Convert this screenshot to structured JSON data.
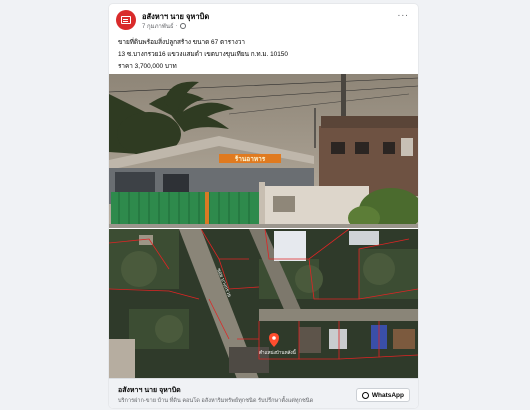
{
  "post": {
    "author": "อสังหาฯ นาย จุหาบิด",
    "time": "7 กุมภาพันธ์",
    "separator": "·",
    "more_label": "···",
    "text_lines": [
      "ขายที่ดินพร้อมสิ่งปลูกสร้าง  ขนาด  67  ตารางวา",
      "13  ซ.บางกรวย16  แขวงแสมดำ เขตบางขุนเทียน ก.ท.ม.   10150",
      "ราคา  3,700,000  บาท"
    ],
    "house_sign_text": "ร้านอาหาร",
    "map_pin_label": "ตำแหน่งบ้านหลังนี้",
    "map_road_label": "ซอย บางกรวย"
  },
  "footer": {
    "title": "อสังหาฯ นาย จุหาบิด",
    "subtitle": "บริการฝาก-ขาย บ้าน ที่ดิน คอนโด อสังหาริมทรัพย์ทุกชนิด รับปรึกษาตั้งแต่ทุกชนิด",
    "whatsapp_label": "WhatsApp"
  },
  "icons": {
    "avatar": "newspaper-icon",
    "audience": "globe-icon",
    "whatsapp": "whatsapp-icon",
    "map_pin": "map-pin-icon"
  },
  "colors": {
    "avatar": "#d92b2b",
    "fence": "#2e8a4c",
    "sign": "#e07a1f",
    "map_lines": "#e02424",
    "pin": "#ff4d2e"
  }
}
